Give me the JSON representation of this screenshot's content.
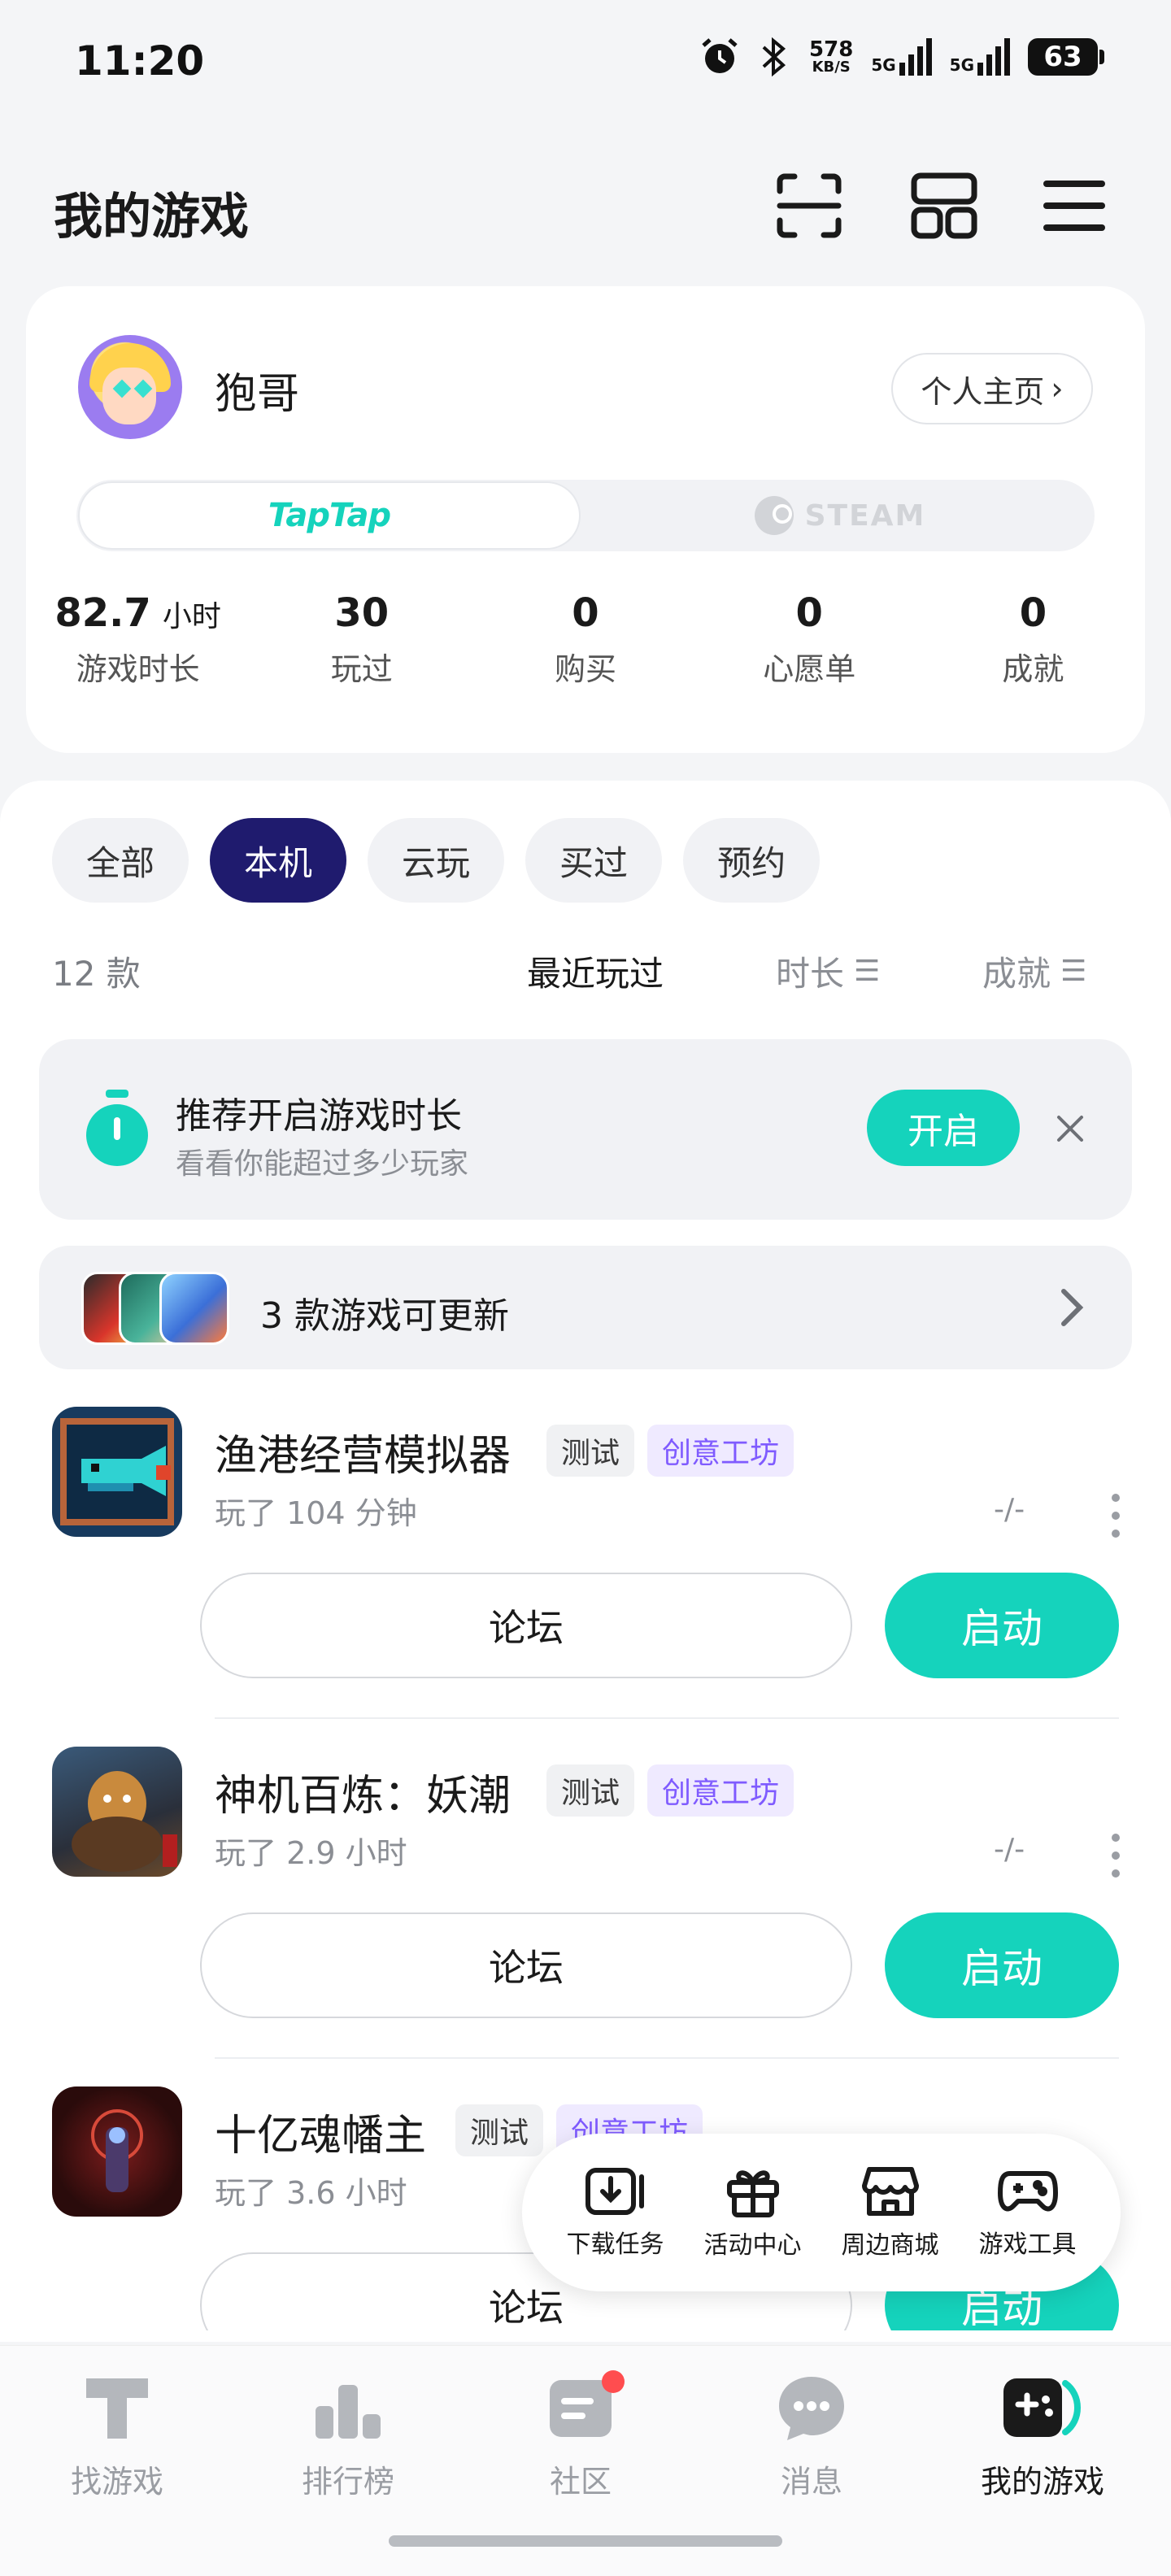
{
  "status_bar": {
    "time": "11:20",
    "net_speed": "578",
    "net_unit": "KB/S",
    "sig1": "5G",
    "sig2": "5G",
    "battery": "63"
  },
  "header": {
    "title": "我的游戏",
    "icons": [
      "scan-icon",
      "grid-icon",
      "menu-icon"
    ]
  },
  "profile": {
    "username": "狍哥",
    "home_link": "个人主页",
    "platforms": {
      "active": "TapTap",
      "inactive": "STEAM"
    },
    "stats": [
      {
        "value": "82.7",
        "unit": "小时",
        "label": "游戏时长"
      },
      {
        "value": "30",
        "label": "玩过"
      },
      {
        "value": "0",
        "label": "购买"
      },
      {
        "value": "0",
        "label": "心愿单"
      },
      {
        "value": "0",
        "label": "成就"
      }
    ]
  },
  "filters": {
    "chips": [
      "全部",
      "本机",
      "云玩",
      "买过",
      "预约"
    ],
    "active_chip": "本机",
    "count": "12 款",
    "sort": [
      "最近玩过",
      "时长",
      "成就"
    ]
  },
  "recommend": {
    "title": "推荐开启游戏时长",
    "subtitle": "看看你能超过多少玩家",
    "button": "开启"
  },
  "updates": {
    "text": "3 款游戏可更新"
  },
  "games": [
    {
      "name": "渔港经营模拟器",
      "tags": [
        "测试",
        "创意工坊"
      ],
      "played": "玩了 104 分钟",
      "achievement": "-/-",
      "forum": "论坛",
      "launch": "启动"
    },
    {
      "name": "神机百炼：妖潮",
      "tags": [
        "测试",
        "创意工坊"
      ],
      "played": "玩了 2.9 小时",
      "achievement": "-/-",
      "forum": "论坛",
      "launch": "启动"
    },
    {
      "name": "十亿魂幡主",
      "tags": [
        "测试",
        "创意工坊"
      ],
      "played": "玩了 3.6 小时",
      "achievement": "",
      "forum": "论坛",
      "launch": "启动"
    }
  ],
  "quick_menu": [
    "下载任务",
    "活动中心",
    "周边商城",
    "游戏工具"
  ],
  "tabbar": [
    "找游戏",
    "排行榜",
    "社区",
    "消息",
    "我的游戏"
  ],
  "colors": {
    "accent": "#15d3bc",
    "chip_active": "#1f1b6e",
    "workshop": "#7f5bff",
    "badge": "#ff4d4f"
  }
}
